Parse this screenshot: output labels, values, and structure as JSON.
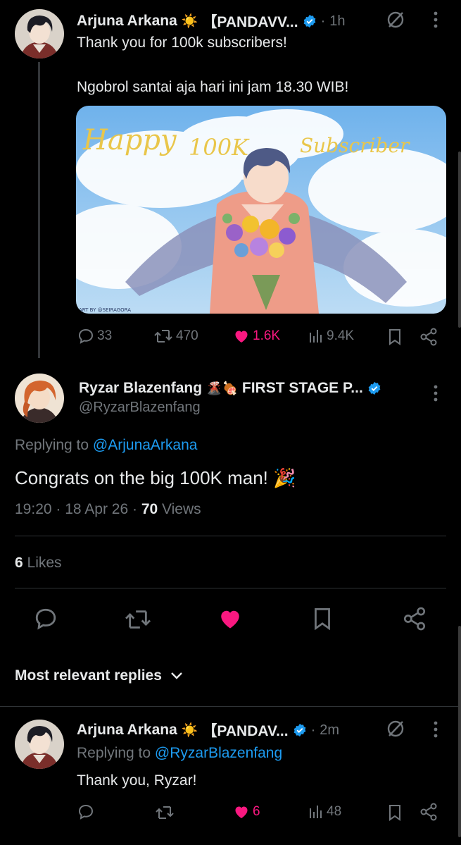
{
  "thread_tweet": {
    "author": "Arjuna Arkana",
    "emoji": "☀️",
    "channel": "【PANDAVV...",
    "time": "1h",
    "line1": "Thank you for 100k subscribers!",
    "line2": "Ngobrol santai aja hari ini jam 18.30 WIB!",
    "image": {
      "text_happy": "Happy",
      "text_100k": "100K",
      "text_sub": "Subscriber",
      "credit": "ART BY @SEIRAGORA"
    },
    "stats": {
      "replies": "33",
      "reposts": "470",
      "likes": "1.6K",
      "views": "9.4K"
    }
  },
  "main_tweet": {
    "author": "Ryzar Blazenfang",
    "emojis": "🌋🍖",
    "channel": "FIRST STAGE P...",
    "handle": "@RyzarBlazenfang",
    "replying_label": "Replying to",
    "replying_to": "@ArjunaArkana",
    "text": "Congrats on the big 100K man! 🎉",
    "time": "19:20",
    "date": "18 Apr 26",
    "views_count": "70",
    "views_label": "Views",
    "likes_count": "6",
    "likes_label": "Likes"
  },
  "replies_header": "Most relevant replies",
  "reply": {
    "author": "Arjuna Arkana",
    "emoji": "☀️",
    "channel": "【PANDAV...",
    "time": "2m",
    "replying_label": "Replying to",
    "replying_to": "@RyzarBlazenfang",
    "text": "Thank you, Ryzar!",
    "stats": {
      "likes": "6",
      "views": "48"
    }
  },
  "colors": {
    "like": "#f91880",
    "verified": "#1d9bf0",
    "link": "#1d9bf0",
    "muted": "#71767b"
  }
}
